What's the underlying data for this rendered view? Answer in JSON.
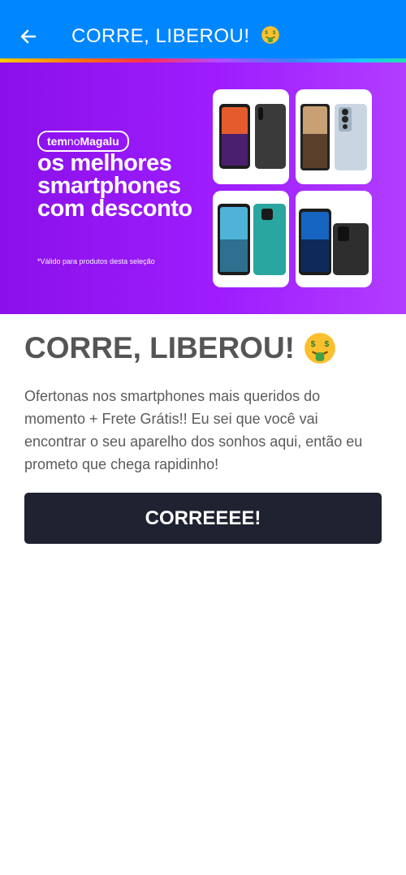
{
  "appbar": {
    "title": "CORRE, LIBEROU!",
    "back_icon": "arrow-left-icon",
    "title_emoji": "money-mouth-face",
    "color": "#0086ff"
  },
  "banner": {
    "brand_prefix": "tem",
    "brand_middle": "no",
    "brand_name": "Magalu",
    "headline_lines": [
      "os melhores",
      "smartphones",
      "com desconto"
    ],
    "disclaimer": "*Válido para produtos desta seleção",
    "background": "#9f1dff"
  },
  "content": {
    "title": "CORRE, LIBEROU!",
    "title_emoji": "money-mouth-face",
    "description": "Ofertonas nos smartphones mais queridos do momento + Frete Grátis!! Eu sei que você vai encontrar o seu aparelho dos sonhos aqui, então eu prometo que chega rapidinho!",
    "cta_label": "CORREEEE!",
    "cta_color": "#1f2230"
  }
}
